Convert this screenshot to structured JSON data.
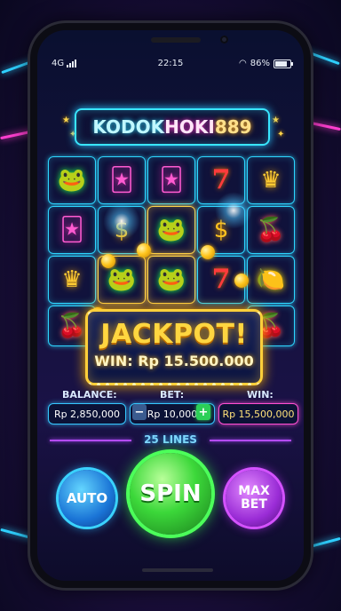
{
  "status_bar": {
    "network": "4G",
    "time": "22:15",
    "battery": "86%"
  },
  "logo": {
    "part1": "KODOK",
    "part2": "HOKI",
    "part3": "889"
  },
  "reels": [
    [
      "frog",
      "jester",
      "jester",
      "seven",
      "crown"
    ],
    [
      "jester",
      "coin",
      "frog",
      "coin",
      "cherry"
    ],
    [
      "crown",
      "frog",
      "frog",
      "seven",
      "lemon"
    ],
    [
      "cherry",
      "",
      "",
      "",
      "cherry"
    ]
  ],
  "symbols": {
    "frog": "🐸",
    "jester": "🃏",
    "seven": "7",
    "crown": "♛",
    "cherry": "🍒",
    "coin": "$",
    "lemon": "🍋"
  },
  "jackpot": {
    "title": "JACKPOT!",
    "win_text": "WIN: Rp 15.500.000"
  },
  "balance": {
    "label": "BALANCE:",
    "value": "Rp 2,850,000"
  },
  "bet": {
    "label": "BET:",
    "value": "Rp 10,000",
    "minus": "−",
    "plus": "+"
  },
  "win": {
    "label": "WIN:",
    "value": "Rp 15,500,000"
  },
  "lines": "25 LINES",
  "buttons": {
    "auto": "AUTO",
    "spin": "SPIN",
    "max_line1": "MAX",
    "max_line2": "BET"
  },
  "colors": {
    "neon_cyan": "#2dd6ff",
    "neon_gold": "#ffcf3a",
    "neon_pink": "#ff4fd2",
    "neon_green": "#4cff5a",
    "neon_purple": "#d452ff"
  }
}
